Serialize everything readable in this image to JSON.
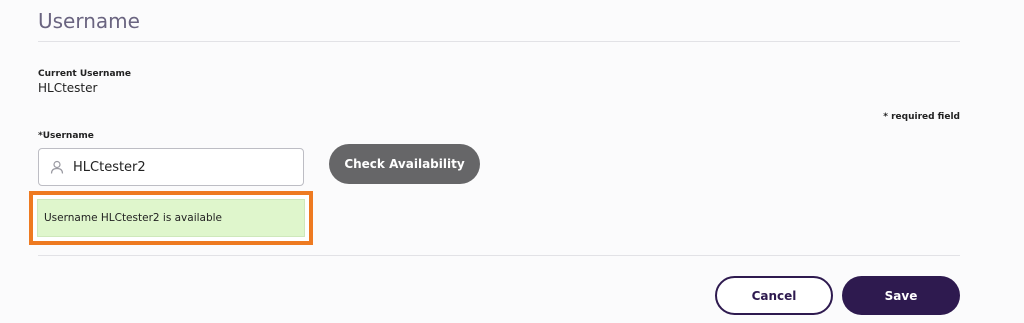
{
  "section": {
    "title": "Username"
  },
  "current": {
    "label": "Current Username",
    "value": "HLCtester"
  },
  "form": {
    "required_note": "* required field",
    "username_label": "*Username",
    "username_value": "HLCtester2",
    "check_label": "Check Availability",
    "availability_message": "Username HLCtester2 is available"
  },
  "actions": {
    "cancel_label": "Cancel",
    "save_label": "Save"
  },
  "colors": {
    "highlight_border": "#ee7a21",
    "success_bg": "#dff6cc",
    "primary": "#2e1a4f",
    "secondary_button": "#666668"
  }
}
